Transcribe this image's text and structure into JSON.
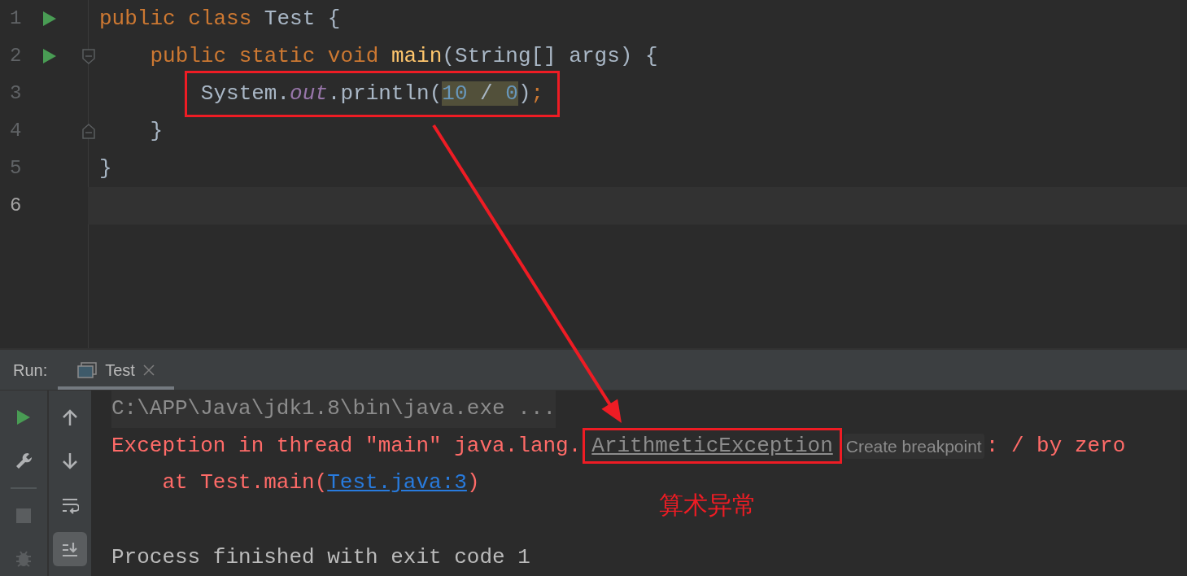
{
  "editor": {
    "lines": [
      {
        "number": "1",
        "run_marker": true,
        "fold_start": false,
        "fold_end": false,
        "current": false,
        "boxed": false,
        "tokens": [
          {
            "text": "public class ",
            "kind": "keyword"
          },
          {
            "text": "Test {",
            "kind": "plain"
          }
        ]
      },
      {
        "number": "2",
        "run_marker": true,
        "fold_start": true,
        "fold_end": false,
        "current": false,
        "boxed": false,
        "tokens": [
          {
            "text": "    public static void ",
            "kind": "keyword"
          },
          {
            "text": "main",
            "kind": "method"
          },
          {
            "text": "(String[] args) {",
            "kind": "plain"
          }
        ]
      },
      {
        "number": "3",
        "run_marker": false,
        "fold_start": false,
        "fold_end": false,
        "current": false,
        "boxed": true,
        "tokens": [
          {
            "text": "        System.",
            "kind": "plain",
            "highlighted": false
          },
          {
            "text": "out",
            "kind": "static-field",
            "highlighted": false
          },
          {
            "text": ".println(",
            "kind": "plain",
            "highlighted": false
          },
          {
            "text": "10",
            "kind": "number",
            "highlighted": true
          },
          {
            "text": " / ",
            "kind": "plain",
            "highlighted": true
          },
          {
            "text": "0",
            "kind": "number",
            "highlighted": true
          },
          {
            "text": ")",
            "kind": "plain",
            "highlighted": false
          },
          {
            "text": ";",
            "kind": "keyword",
            "highlighted": false
          }
        ]
      },
      {
        "number": "4",
        "run_marker": false,
        "fold_start": false,
        "fold_end": true,
        "current": false,
        "boxed": false,
        "tokens": [
          {
            "text": "    }",
            "kind": "plain"
          }
        ]
      },
      {
        "number": "5",
        "run_marker": false,
        "fold_start": false,
        "fold_end": false,
        "current": false,
        "boxed": false,
        "tokens": [
          {
            "text": "}",
            "kind": "plain"
          }
        ]
      },
      {
        "number": "6",
        "run_marker": false,
        "fold_start": false,
        "fold_end": false,
        "current": true,
        "boxed": false
      }
    ]
  },
  "run_panel": {
    "label": "Run:",
    "tabs": [
      {
        "label": "Test",
        "selected": true
      }
    ],
    "left_toolbar": [
      {
        "kind": "run",
        "disabled": false
      },
      {
        "kind": "wrench",
        "disabled": false
      },
      {
        "kind": "stop",
        "disabled": true
      },
      {
        "kind": "debug",
        "disabled": true
      }
    ],
    "right_toolbar": [
      {
        "kind": "up",
        "on": false
      },
      {
        "kind": "down",
        "on": false
      },
      {
        "kind": "wrap",
        "on": false
      },
      {
        "kind": "scroll-end",
        "on": true
      }
    ],
    "console": [
      {
        "kind": "command",
        "text": "C:\\APP\\Java\\jdk1.8\\bin\\java.exe ..."
      },
      {
        "kind": "exception",
        "prefix": "Exception in thread \"main\" java.lang.",
        "link": "ArithmeticException",
        "boxed": true,
        "hint": "Create breakpoint",
        "suffix": ": / by zero"
      },
      {
        "kind": "trace",
        "prefix": "    at Test.main(",
        "link": "Test.java:3",
        "suffix": ")"
      },
      {
        "kind": "blank"
      },
      {
        "kind": "info",
        "text": "Process finished with exit code 1"
      }
    ]
  },
  "annotations": {
    "arrow": true,
    "note": "算术异常"
  }
}
